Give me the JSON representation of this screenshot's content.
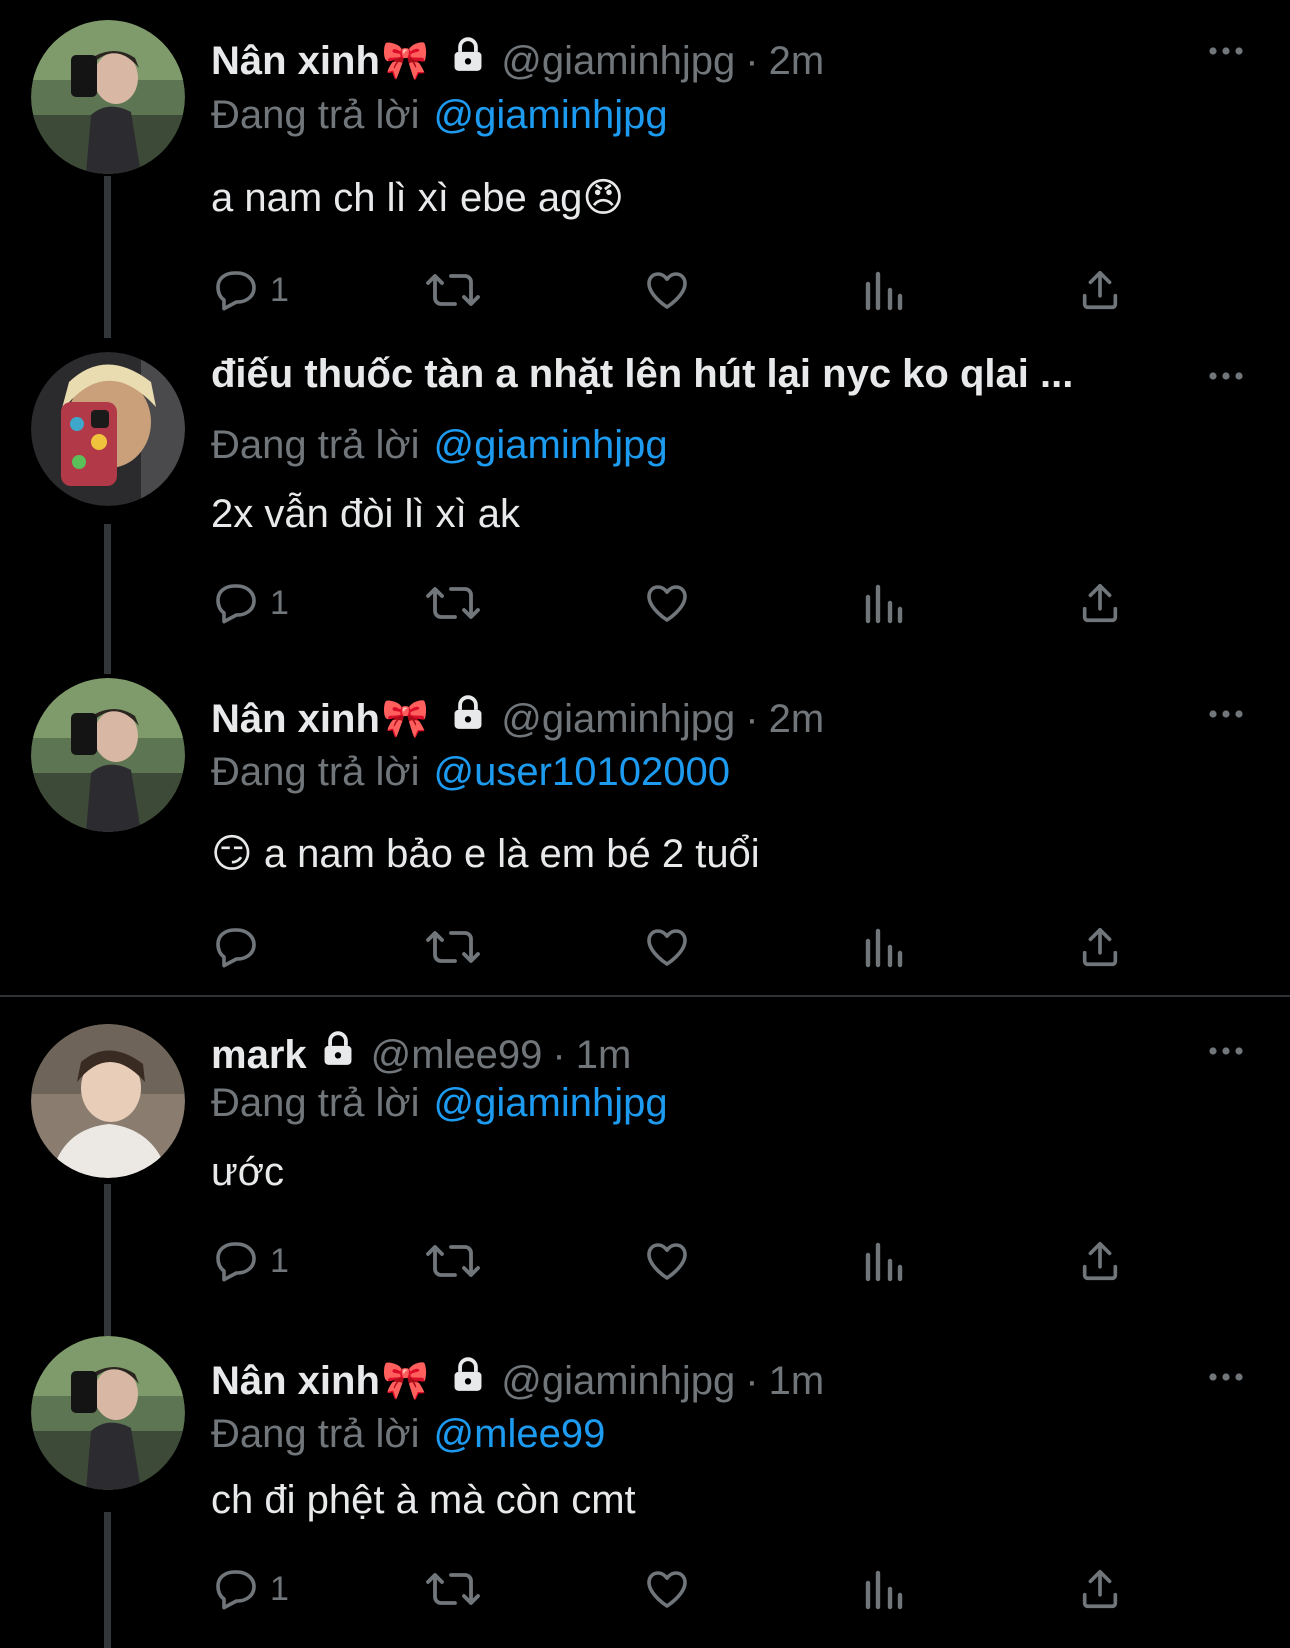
{
  "colors": {
    "background": "#000000",
    "text": "#e7e9ea",
    "muted": "#71767b",
    "link": "#1d9bf0",
    "divider": "#2f3336"
  },
  "icons": {
    "more": "more-horizontal-icon",
    "lock": "lock-icon",
    "reply": "reply-icon",
    "retweet": "retweet-icon",
    "like": "heart-icon",
    "views": "views-chart-icon",
    "share": "share-icon"
  },
  "tweets": [
    {
      "name": "Nân xinh",
      "name_emoji": "🎀",
      "handle": "@giaminhjpg",
      "dot": "·",
      "time": "2m",
      "reply_label": "Đang trả lời",
      "reply_to": "@giaminhjpg",
      "text": "a nam ch lì xì ebe ag😠",
      "reply_count": "1"
    },
    {
      "name": "điếu thuốc tàn a nhặt lên hút lại nyc ko qlai ...",
      "reply_label": "Đang trả lời",
      "reply_to": "@giaminhjpg",
      "text": "2x vẫn đòi lì xì ak",
      "reply_count": "1"
    },
    {
      "name": "Nân xinh",
      "name_emoji": "🎀",
      "handle": "@giaminhjpg",
      "dot": "·",
      "time": "2m",
      "reply_label": "Đang trả lời",
      "reply_to": "@user10102000",
      "text": "😏 a nam bảo e là em bé 2 tuổi",
      "reply_count": ""
    },
    {
      "name": "mark",
      "handle": "@mlee99",
      "dot": "·",
      "time": "1m",
      "reply_label": "Đang trả lời",
      "reply_to": "@giaminhjpg",
      "text": "ước",
      "reply_count": "1"
    },
    {
      "name": "Nân xinh",
      "name_emoji": "🎀",
      "handle": "@giaminhjpg",
      "dot": "·",
      "time": "1m",
      "reply_label": "Đang trả lời",
      "reply_to": "@mlee99",
      "text": "ch đi phệt à mà còn cmt",
      "reply_count": "1"
    }
  ]
}
